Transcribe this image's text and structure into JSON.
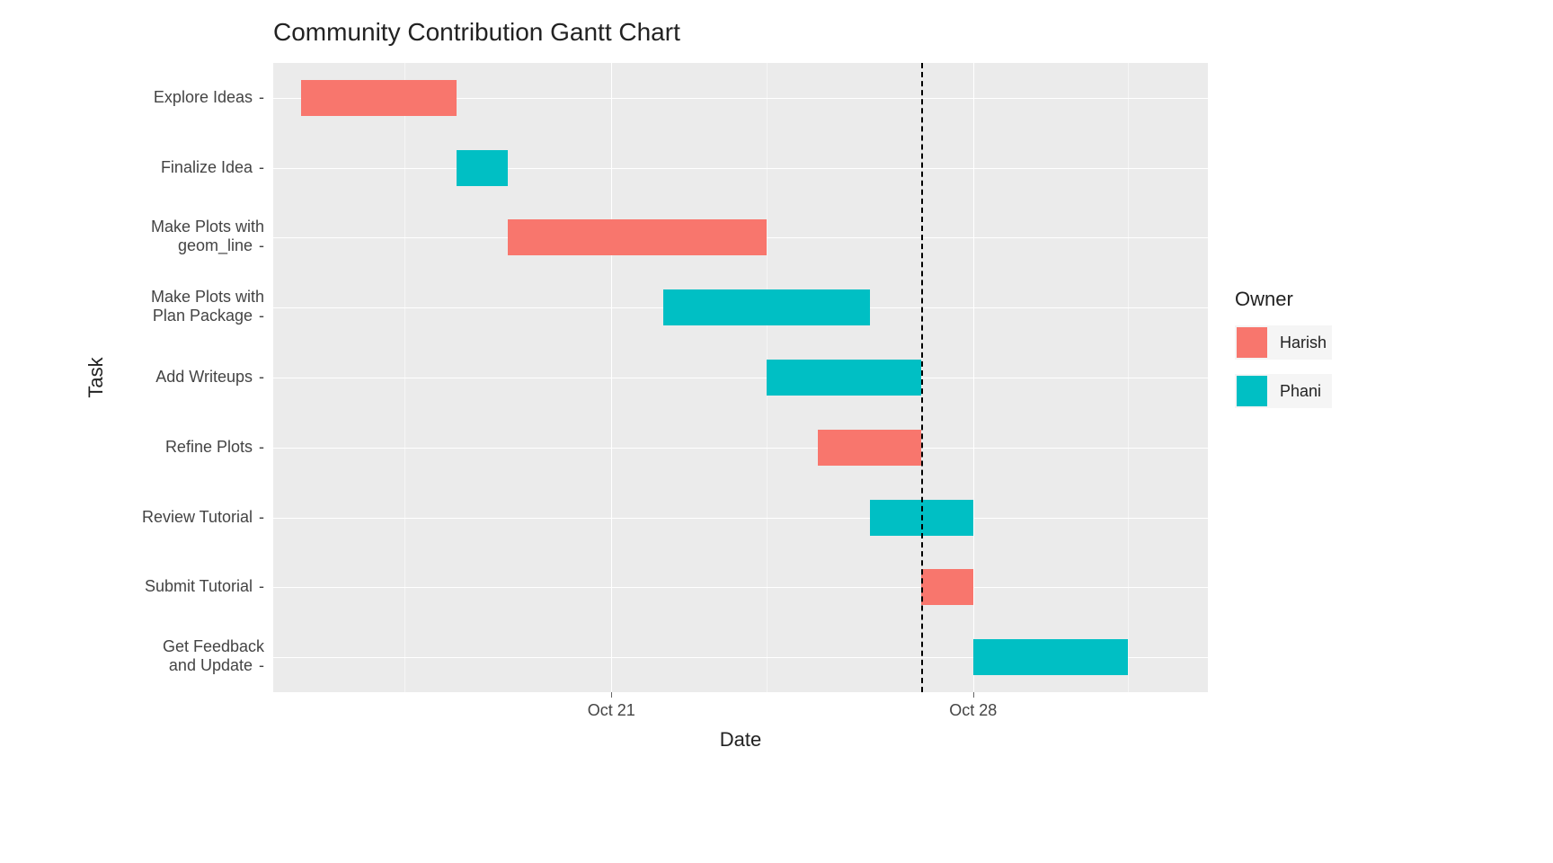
{
  "chart_data": {
    "type": "bar",
    "orientation": "horizontal-gantt",
    "title": "Community Contribution Gantt Chart",
    "xlabel": "Date",
    "ylabel": "Task",
    "x_axis": {
      "type": "date",
      "range": [
        "2019-10-15",
        "2019-11-01"
      ],
      "ticks": [
        "Oct 21",
        "Oct 28"
      ],
      "tick_values": [
        "2019-10-21",
        "2019-10-28"
      ]
    },
    "legend": {
      "title": "Owner",
      "items": [
        {
          "name": "Harish",
          "color": "#f8766d"
        },
        {
          "name": "Phani",
          "color": "#00bfc4"
        }
      ]
    },
    "vline": {
      "x": "2019-10-27",
      "style": "dashed"
    },
    "categories": [
      "Explore Ideas",
      "Finalize Idea",
      "Make Plots with\ngeom_line",
      "Make Plots with\nPlan Package",
      "Add Writeups",
      "Refine Plots",
      "Review Tutorial",
      "Submit Tutorial",
      "Get Feedback\nand Update"
    ],
    "tasks": [
      {
        "task": "Explore Ideas",
        "owner": "Harish",
        "start": "2019-10-15",
        "end": "2019-10-18"
      },
      {
        "task": "Finalize Idea",
        "owner": "Phani",
        "start": "2019-10-18",
        "end": "2019-10-19"
      },
      {
        "task": "Make Plots with geom_line",
        "owner": "Harish",
        "start": "2019-10-19",
        "end": "2019-10-24"
      },
      {
        "task": "Make Plots with Plan Package",
        "owner": "Phani",
        "start": "2019-10-22",
        "end": "2019-10-26"
      },
      {
        "task": "Add Writeups",
        "owner": "Phani",
        "start": "2019-10-24",
        "end": "2019-10-27"
      },
      {
        "task": "Refine Plots",
        "owner": "Harish",
        "start": "2019-10-25",
        "end": "2019-10-27"
      },
      {
        "task": "Review Tutorial",
        "owner": "Phani",
        "start": "2019-10-26",
        "end": "2019-10-28"
      },
      {
        "task": "Submit Tutorial",
        "owner": "Harish",
        "start": "2019-10-27",
        "end": "2019-10-28"
      },
      {
        "task": "Get Feedback and Update",
        "owner": "Phani",
        "start": "2019-10-28",
        "end": "2019-10-31"
      }
    ]
  }
}
